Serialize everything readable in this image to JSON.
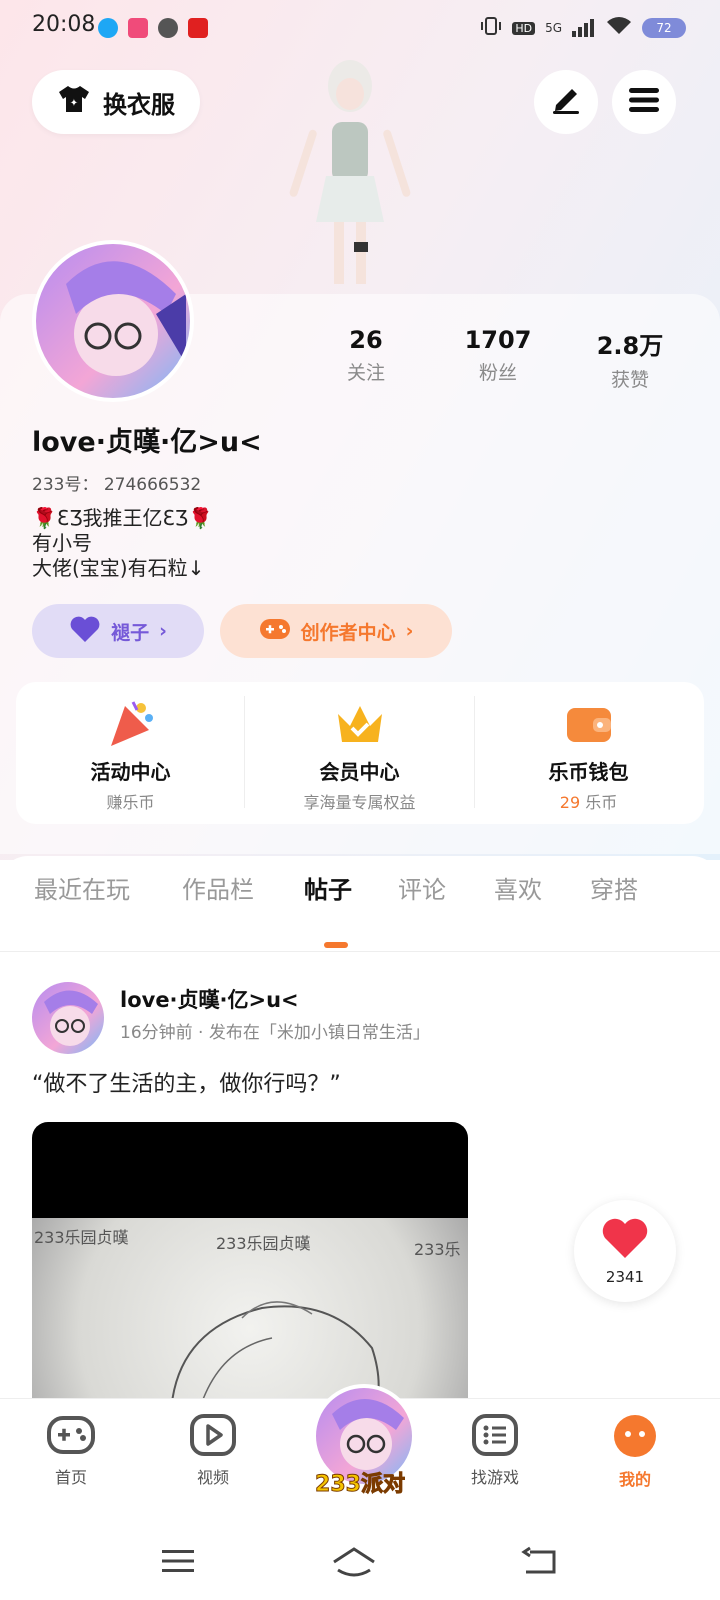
{
  "status_bar": {
    "time": "20:08",
    "network": "5G",
    "hd": "HD",
    "battery": "72"
  },
  "header": {
    "dress_button": "换衣服",
    "edit_icon": "edit-icon",
    "menu_icon": "menu-icon"
  },
  "profile": {
    "stats": [
      {
        "value": "26",
        "label": "关注"
      },
      {
        "value": "1707",
        "label": "粉丝"
      },
      {
        "value": "2.8万",
        "label": "获赞"
      }
    ],
    "nickname": "love·贞暵·亿>u<",
    "uid_line": "233号： 274666532",
    "bio": [
      "🌹ƐƷ我推王亿ƐƷ🌹",
      "有小号",
      "大佬(宝宝)有石粒↓"
    ],
    "badge_label": "褪子",
    "creator_label": "创作者中心"
  },
  "services": [
    {
      "title": "活动中心",
      "sub": "赚乐币"
    },
    {
      "title": "会员中心",
      "sub": "享海量专属权益"
    },
    {
      "title": "乐币钱包",
      "sub_value": "29",
      "sub": "乐币"
    }
  ],
  "tabs": [
    "最近在玩",
    "作品栏",
    "帖子",
    "评论",
    "喜欢",
    "穿搭"
  ],
  "active_tab": "帖子",
  "post": {
    "author": "love·贞暵·亿>u<",
    "meta": "16分钟前 · 发布在「米加小镇日常生活」",
    "text": "“做不了生活的主，做你行吗？”",
    "watermarks": [
      "233乐园贞暵",
      "233乐园贞暵",
      "233乐"
    ]
  },
  "like": {
    "count": "2341"
  },
  "bottom_nav": [
    {
      "label": "首页",
      "icon": "gamepad-icon"
    },
    {
      "label": "视频",
      "icon": "play-icon"
    },
    {
      "label": "233派对",
      "icon": "party-avatar"
    },
    {
      "label": "找游戏",
      "icon": "list-icon"
    },
    {
      "label": "我的",
      "icon": "me-icon"
    }
  ],
  "colors": {
    "accent": "#f5782e",
    "purple": "#7559d8",
    "like": "#f0344a"
  }
}
